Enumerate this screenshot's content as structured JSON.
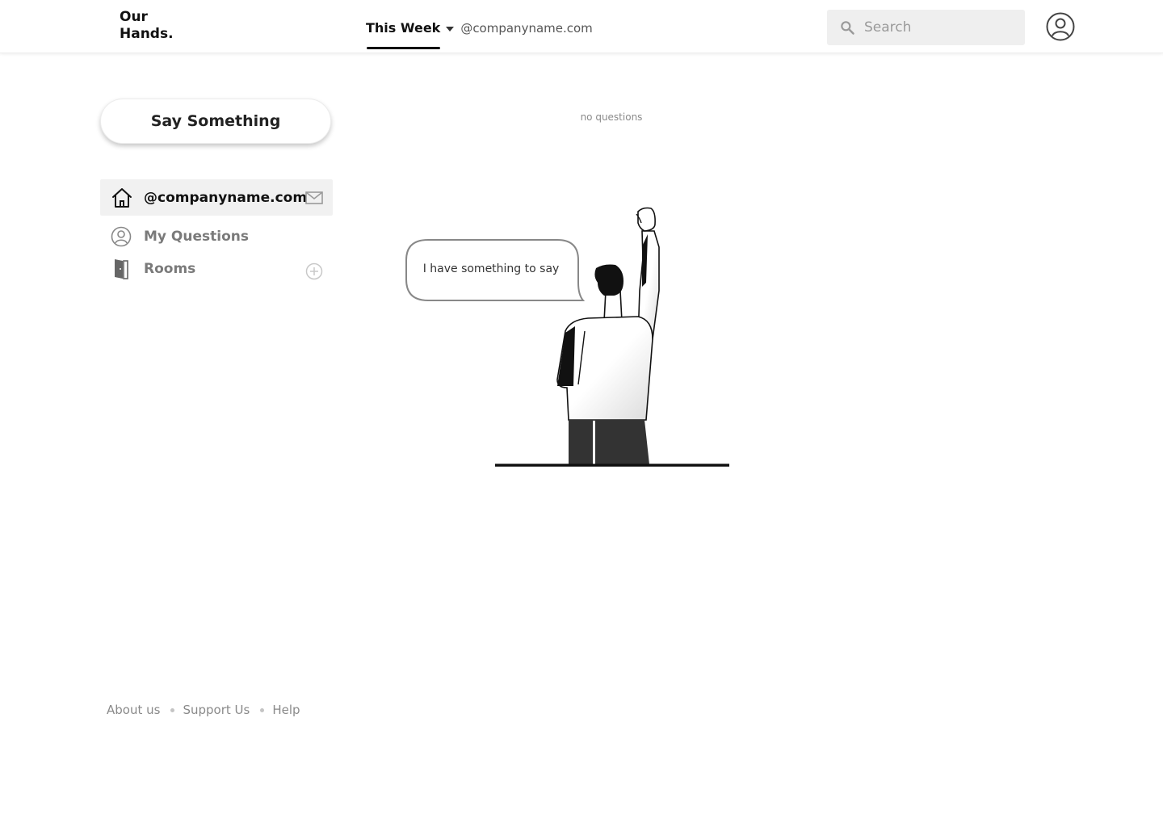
{
  "header": {
    "logo_line1": "Our",
    "logo_line2": "Hands.",
    "week_tab": "This Week",
    "domain": "@companyname.com",
    "search_placeholder": "Search"
  },
  "sidebar": {
    "say_button": "Say Something",
    "items": [
      {
        "label": "@companyname.com",
        "icon": "home-icon",
        "right_icon": "mail-icon",
        "active": true
      },
      {
        "label": "My Questions",
        "icon": "user-circle-icon",
        "active": false
      },
      {
        "label": "Rooms",
        "icon": "door-icon",
        "right_icon": "plus-circle-icon",
        "active": false
      }
    ]
  },
  "main": {
    "empty_text": "no questions",
    "bubble_text": "I have something to say"
  },
  "footer": {
    "links": [
      "About us",
      "Support Us",
      "Help"
    ]
  },
  "colors": {
    "accent": "#111111",
    "muted": "#8a8a8a",
    "active_bg": "#f1f1f1",
    "search_bg": "#efefef"
  }
}
